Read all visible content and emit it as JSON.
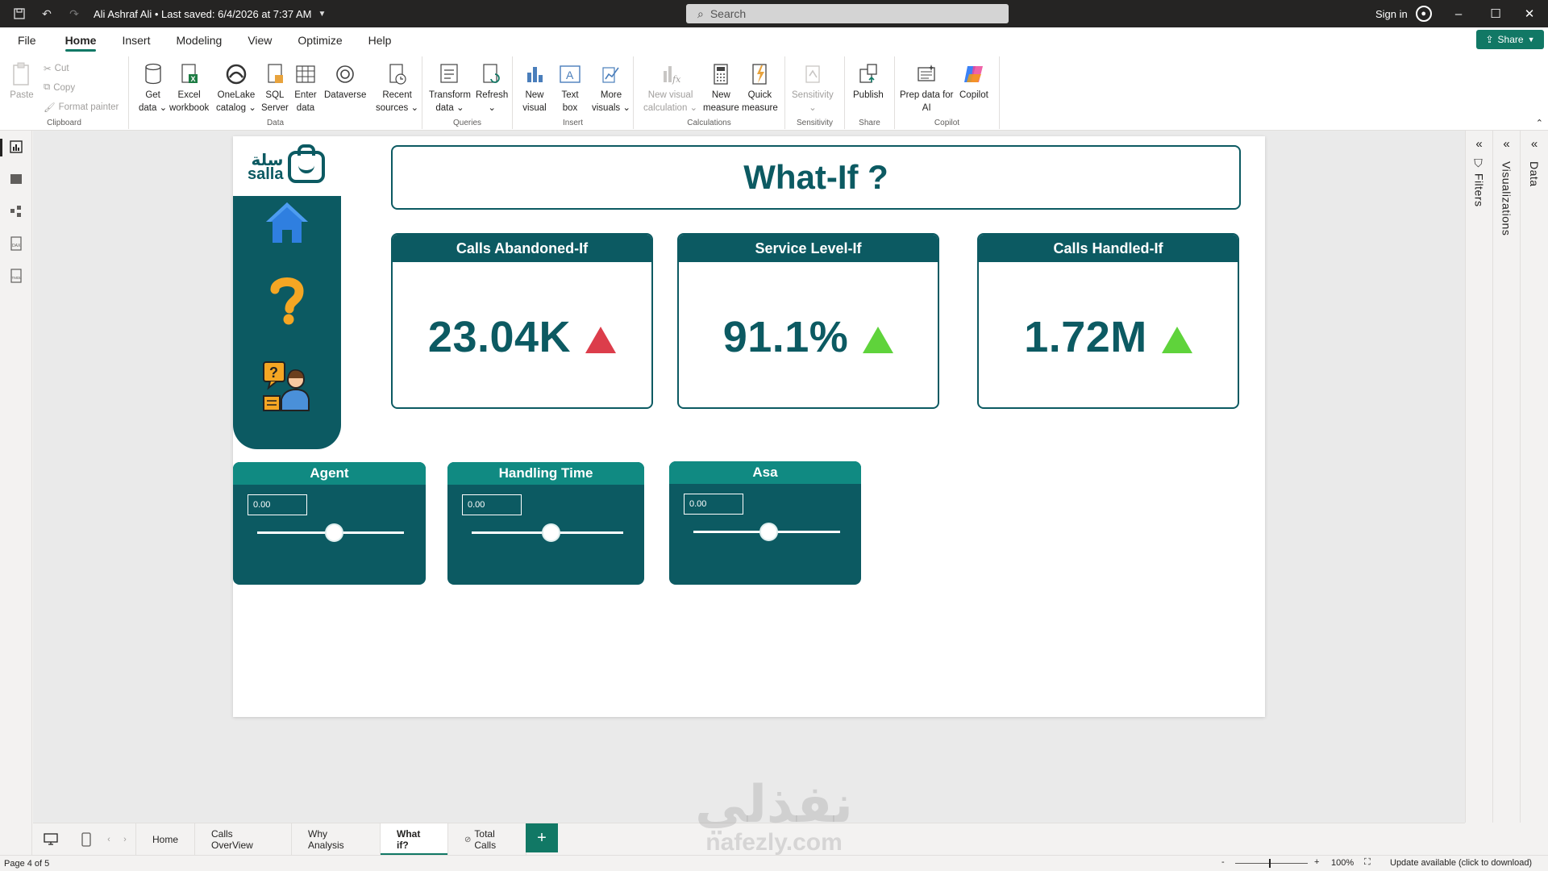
{
  "titlebar": {
    "title": "Ali Ashraf Ali • Last saved: 6/4/2026 at 7:37 AM",
    "search_placeholder": "Search",
    "sign_in": "Sign in"
  },
  "menu": {
    "items": [
      "File",
      "Home",
      "Insert",
      "Modeling",
      "View",
      "Optimize",
      "Help"
    ],
    "active": "Home",
    "share": "Share"
  },
  "ribbon": {
    "clipboard": {
      "paste": "Paste",
      "cut": "Cut",
      "copy": "Copy",
      "format_painter": "Format painter",
      "label": "Clipboard"
    },
    "data": {
      "get_data": [
        "Get",
        "data"
      ],
      "excel": [
        "Excel",
        "workbook"
      ],
      "onelake": [
        "OneLake",
        "catalog"
      ],
      "sql": [
        "SQL",
        "Server"
      ],
      "enter": [
        "Enter",
        "data"
      ],
      "dataverse": [
        "Dataverse",
        ""
      ],
      "recent": [
        "Recent",
        "sources"
      ],
      "label": "Data"
    },
    "queries": {
      "transform": [
        "Transform",
        "data"
      ],
      "refresh": [
        "Refresh",
        ""
      ],
      "label": "Queries"
    },
    "insert": {
      "new_visual": [
        "New",
        "visual"
      ],
      "text_box": [
        "Text",
        "box"
      ],
      "more_visuals": [
        "More",
        "visuals"
      ],
      "label": "Insert"
    },
    "calculations": {
      "new_visual_calc": [
        "New visual",
        "calculation"
      ],
      "new_measure": [
        "New",
        "measure"
      ],
      "quick_measure": [
        "Quick",
        "measure"
      ],
      "label": "Calculations"
    },
    "sensitivity": {
      "sensitivity": [
        "Sensitivity",
        ""
      ],
      "label": "Sensitivity"
    },
    "share": {
      "publish": [
        "Publish",
        ""
      ],
      "label": "Share"
    },
    "copilot": {
      "prep": [
        "Prep data for",
        "AI"
      ],
      "copilot": [
        "Copilot",
        ""
      ],
      "label": "Copilot"
    }
  },
  "panes": {
    "filters": "Filters",
    "visualizations": "Visualizations",
    "data": "Data"
  },
  "report": {
    "logo_text_ar": "سلة",
    "logo_text_en": "salla",
    "title": "What-If ?",
    "kpis": [
      {
        "title": "Calls Abandoned-If",
        "value": "23.04K",
        "trend": "up",
        "trend_color": "#dc3d4b"
      },
      {
        "title": "Service Level-If",
        "value": "91.1%",
        "trend": "up",
        "trend_color": "#5fd33b"
      },
      {
        "title": "Calls Handled-If",
        "value": "1.72M",
        "trend": "up",
        "trend_color": "#5fd33b"
      }
    ],
    "slicers": [
      {
        "title": "Agent",
        "value": "0.00",
        "position": 0.52
      },
      {
        "title": "Handling Time",
        "value": "0.00",
        "position": 0.52
      },
      {
        "title": "Asa",
        "value": "0.00",
        "position": 0.51
      }
    ],
    "nav_icons": [
      "home-icon",
      "question-icon",
      "support-agent-icon"
    ]
  },
  "tabs": {
    "pages": [
      "Home",
      "Calls OverView",
      "Why Analysis",
      "What if?",
      "Total Calls"
    ],
    "active": "What if?",
    "add": "+"
  },
  "watermark": {
    "ar": "نفذلي",
    "en": "nafezly.com"
  },
  "status": {
    "page": "Page 4 of 5",
    "zoom_minus": "-",
    "zoom_plus": "+",
    "zoom": "100%",
    "update": "Update available (click to download)"
  },
  "colors": {
    "accent": "#117865",
    "teal_dark": "#0c5a62",
    "slicer_head": "#108a82",
    "up_green": "#5fd33b",
    "up_red": "#dc3d4b"
  }
}
